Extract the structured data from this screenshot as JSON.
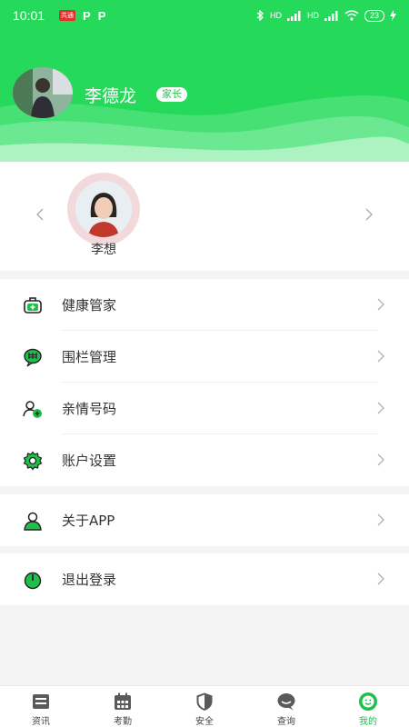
{
  "status_bar": {
    "time": "10:01",
    "badge": "共通",
    "p1": "P",
    "p2": "P",
    "signal1": "HD",
    "signal2": "HD",
    "battery": "23"
  },
  "profile": {
    "name": "李德龙",
    "role": "家长"
  },
  "child": {
    "name": "李想"
  },
  "menu": {
    "health": "健康管家",
    "fence": "围栏管理",
    "family_numbers": "亲情号码",
    "account_settings": "账户设置",
    "about": "关于APP",
    "logout": "退出登录"
  },
  "bottom_nav": {
    "news": "资讯",
    "attendance": "考勤",
    "safety": "安全",
    "query": "查询",
    "mine": "我的"
  },
  "colors": {
    "accent": "#25d95a",
    "icon_green": "#1fbf4c",
    "text": "#333333",
    "background": "#f4f4f4"
  }
}
